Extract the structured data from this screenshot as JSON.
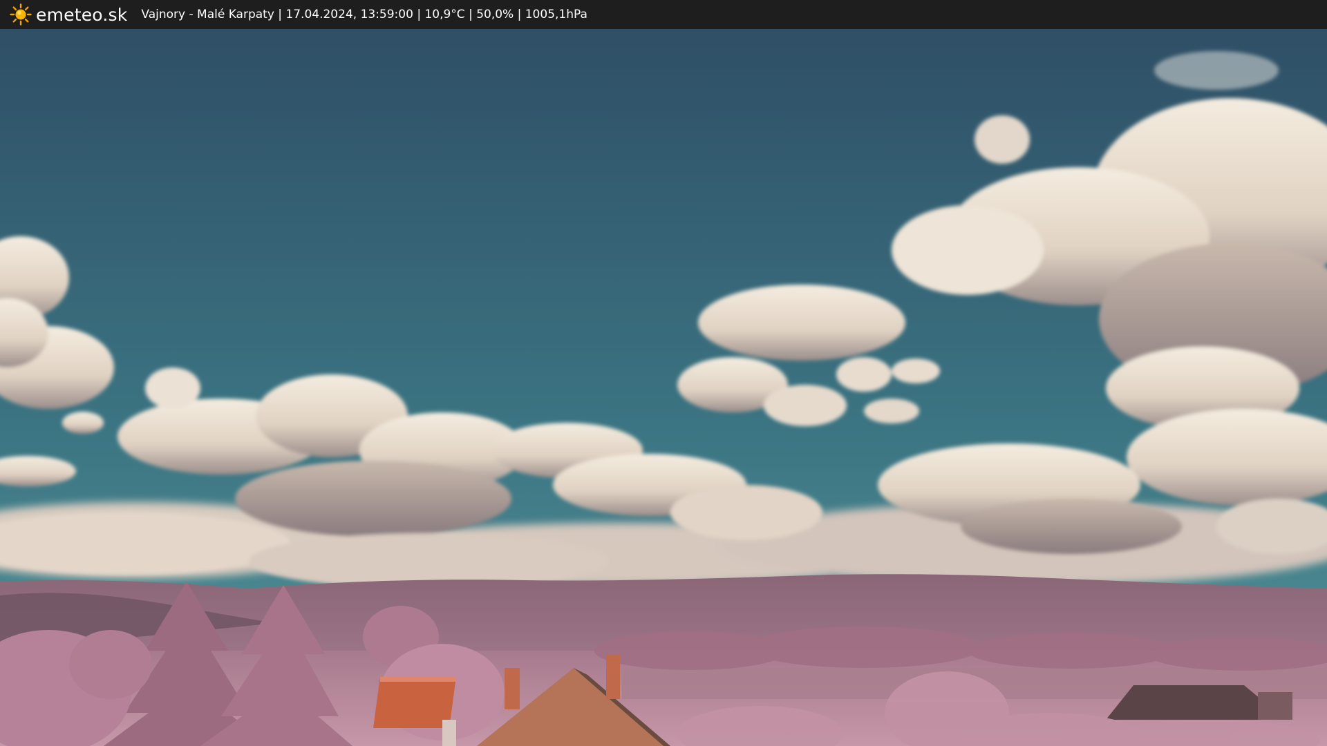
{
  "header": {
    "site_name": "emeteo.sk",
    "logo_icon": "sun-icon",
    "caption": "Vajnory - Malé Karpaty | 17.04.2024, 13:59:00 | 10,9°C | 50,0% | 1005,1hPa"
  },
  "colors": {
    "header_bg": "#1e1e1e",
    "sky_top": "#2f4f66",
    "sky_bottom": "#3f7c86",
    "cloud": "#ece2d3",
    "hills": "#9c6f85",
    "foliage": "#b88597",
    "roof": "#c9623e"
  }
}
